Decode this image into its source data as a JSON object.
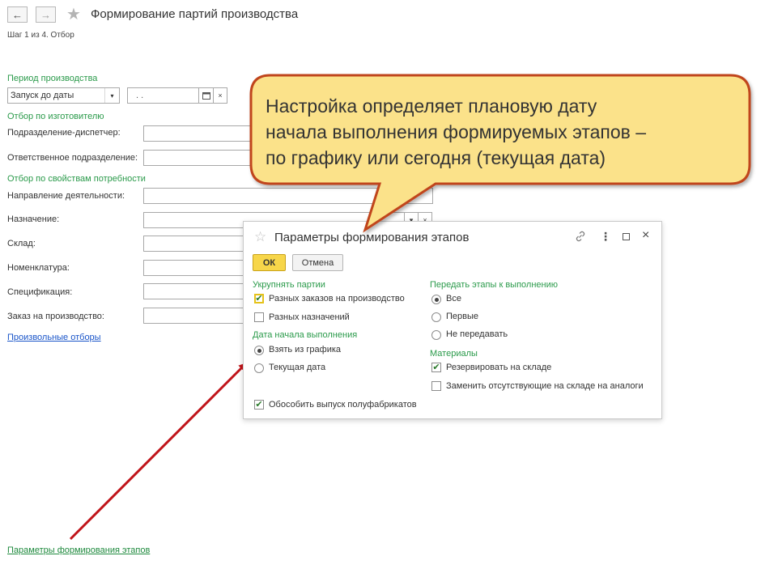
{
  "header": {
    "back_icon": "arrow-left-icon",
    "forward_icon": "arrow-right-icon",
    "star_icon": "star-icon",
    "title": "Формирование партий производства",
    "step": "Шаг 1 из 4. Отбор"
  },
  "form": {
    "period_group": "Период производства",
    "period_select_value": "Запуск до даты",
    "date_value": ".  .",
    "calendar_icon": "calendar-icon",
    "clear_icon": "clear-icon",
    "manufacturer_group": "Отбор по изготовителю",
    "dispatcher_label": "Подразделение-диспетчер:",
    "responsible_label": "Ответственное подразделение:",
    "need_props_group": "Отбор по свойствам потребности",
    "activity_label": "Направление деятельности:",
    "purpose_label": "Назначение:",
    "warehouse_label": "Склад:",
    "nomenclature_label": "Номенклатура:",
    "specification_label": "Спецификация:",
    "order_label": "Заказ на производство:",
    "custom_filters_link": "Произвольные отборы",
    "stage_params_link": "Параметры формирования этапов"
  },
  "callout": {
    "line1": "Настройка определяет плановую дату",
    "line2": "начала выполнения формируемых этапов –",
    "line3": "по графику или сегодня (текущая дата)",
    "fill_color": "#fbe28a",
    "border_color": "#c0441a"
  },
  "dialog": {
    "title": "Параметры формирования этапов",
    "ok_label": "ОК",
    "cancel_label": "Отмена",
    "enlarge_group": "Укрупнять партии",
    "diff_orders": {
      "label": "Разных заказов на производство",
      "checked": true
    },
    "diff_purposes": {
      "label": "Разных назначений",
      "checked": false
    },
    "start_date_group": "Дата начала выполнения",
    "take_from_schedule": {
      "label": "Взять из графика",
      "selected": true
    },
    "current_date": {
      "label": "Текущая дата",
      "selected": false
    },
    "separate_semifinished": {
      "label": "Обособить выпуск полуфабрикатов",
      "checked": true
    },
    "transfer_group": "Передать этапы к выполнению",
    "transfer_all": {
      "label": "Все",
      "selected": true
    },
    "transfer_first": {
      "label": "Первые",
      "selected": false
    },
    "transfer_none": {
      "label": "Не передавать",
      "selected": false
    },
    "materials_group": "Материалы",
    "reserve_in_stock": {
      "label": "Резервировать на складе",
      "checked": true
    },
    "replace_missing": {
      "label": "Заменить отсутствующие на складе на аналоги",
      "checked": false
    }
  },
  "arrow_color": "#c0141a"
}
